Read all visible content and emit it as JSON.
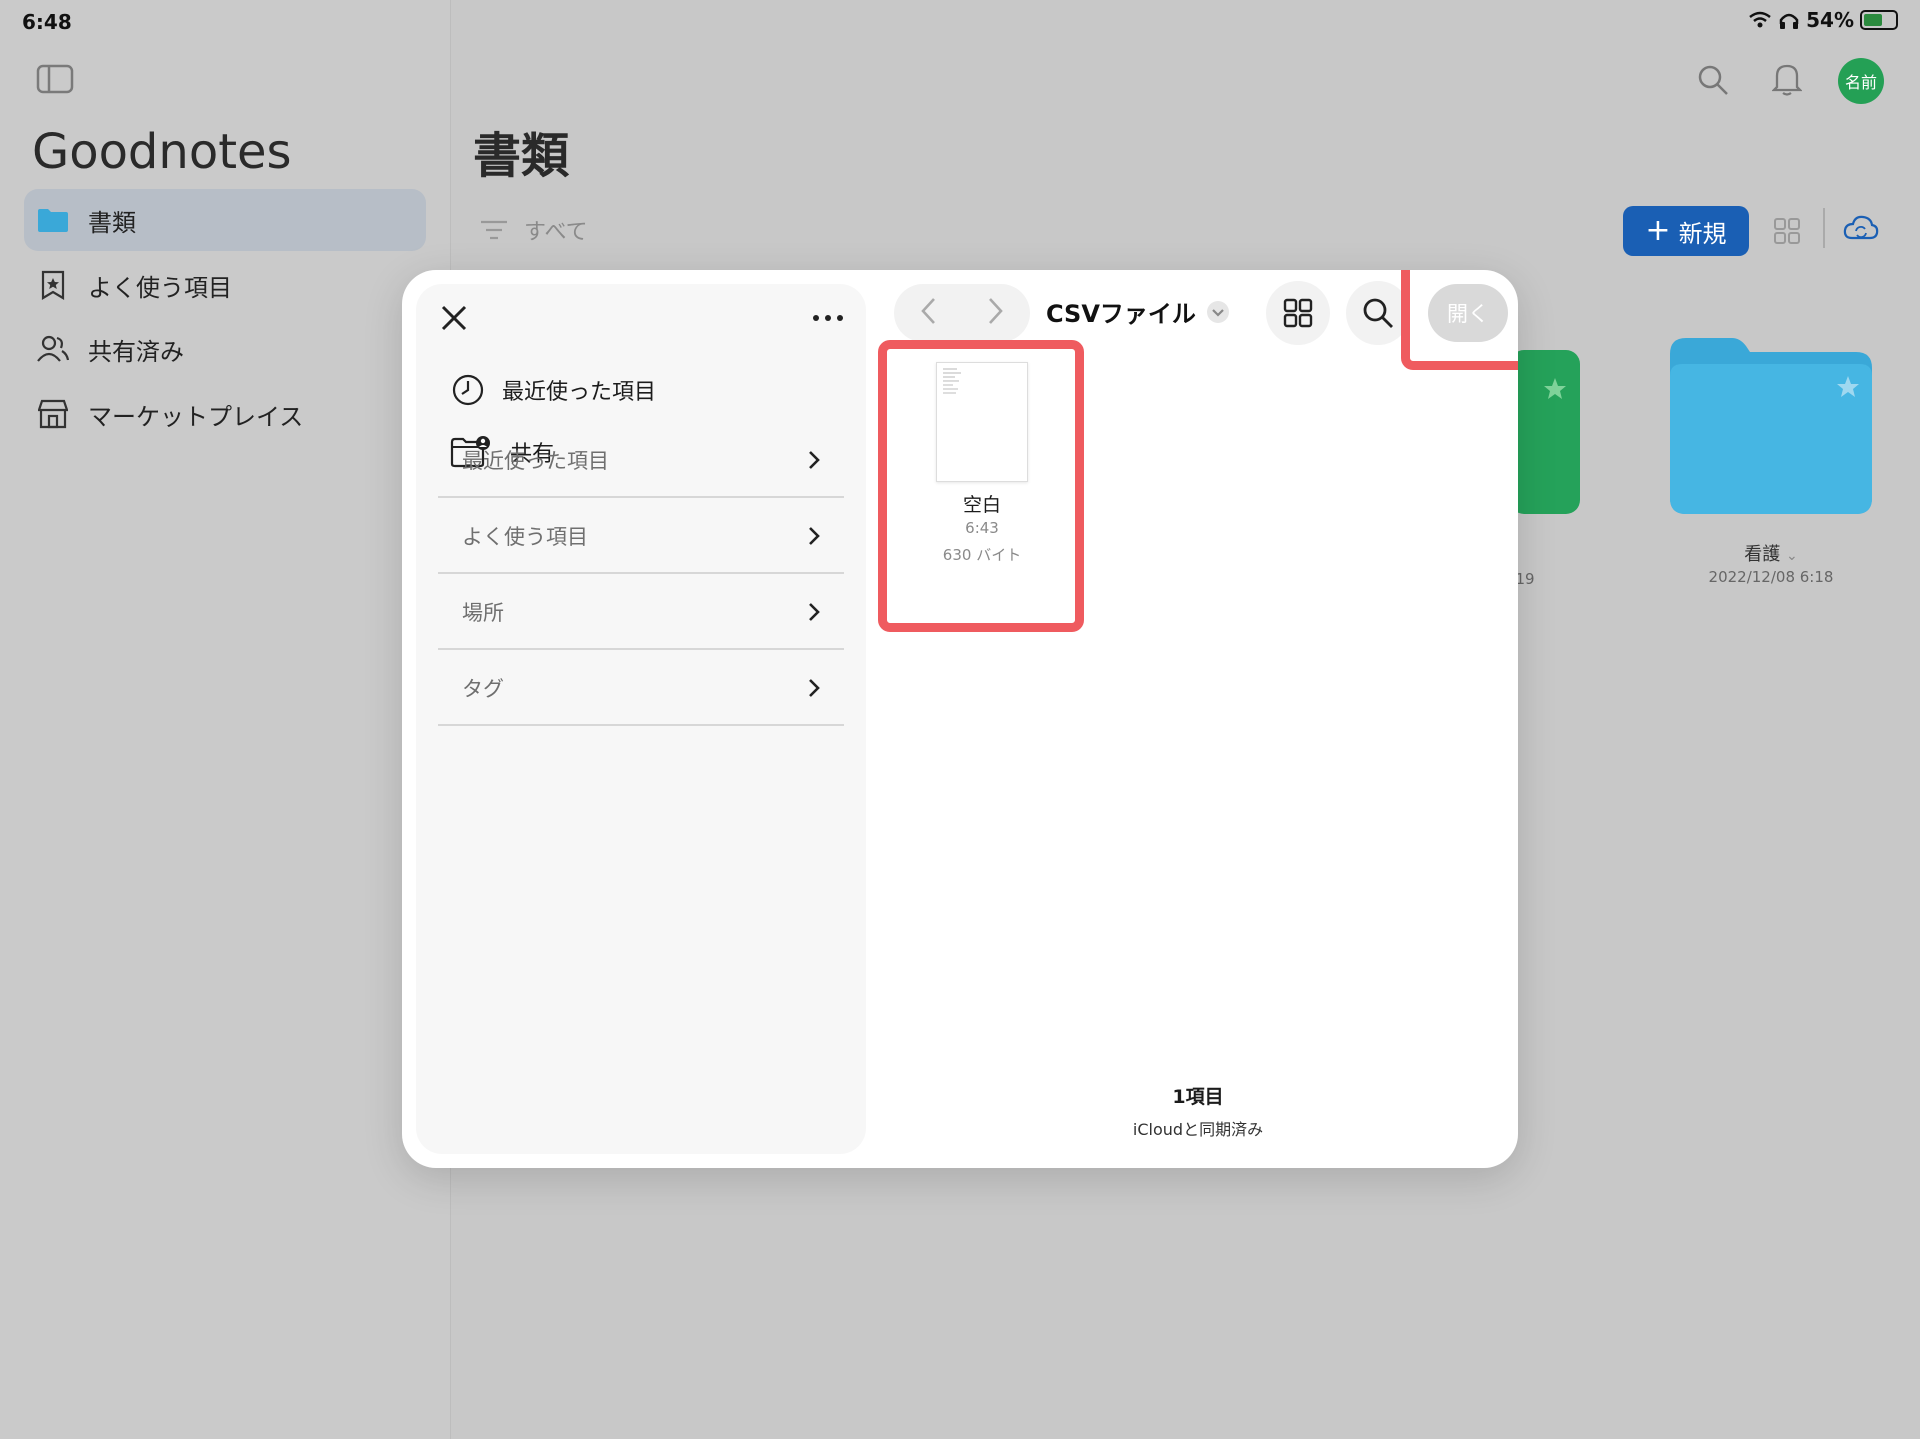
{
  "status": {
    "time": "6:48",
    "battery": "54%"
  },
  "sidebar": {
    "app_title": "Goodnotes",
    "items": [
      {
        "label": "書類",
        "icon": "folder-icon",
        "active": true
      },
      {
        "label": "よく使う項目",
        "icon": "bookmark-star-icon",
        "active": false
      },
      {
        "label": "共有済み",
        "icon": "people-icon",
        "active": false
      },
      {
        "label": "マーケットプレイス",
        "icon": "store-icon",
        "active": false
      }
    ]
  },
  "main": {
    "heading": "書類",
    "filter_label": "すべて",
    "new_button": "新規",
    "avatar_text": "名前",
    "folders": [
      {
        "label": "看護",
        "date": "2022/12/08 6:18",
        "color": "#3aa8d8"
      },
      {
        "partial_date": "19",
        "color": "#25a25a"
      }
    ]
  },
  "dialog": {
    "folder_title": "CSVファイル",
    "open_button": "開く",
    "quick_items": [
      {
        "label": "最近使った項目",
        "icon": "clock-icon"
      },
      {
        "label": "共有",
        "icon": "shared-folder-icon"
      }
    ],
    "sections": [
      {
        "label": "最近使った項目"
      },
      {
        "label": "よく使う項目"
      },
      {
        "label": "場所"
      },
      {
        "label": "タグ"
      }
    ],
    "file": {
      "name": "空白",
      "time": "6:43",
      "size": "630 バイト"
    },
    "footer": {
      "count": "1項目",
      "sync": "iCloudと同期済み"
    }
  },
  "colors": {
    "accent": "#1a5fb4",
    "highlight": "#ef5b5f",
    "avatar": "#24a055"
  }
}
